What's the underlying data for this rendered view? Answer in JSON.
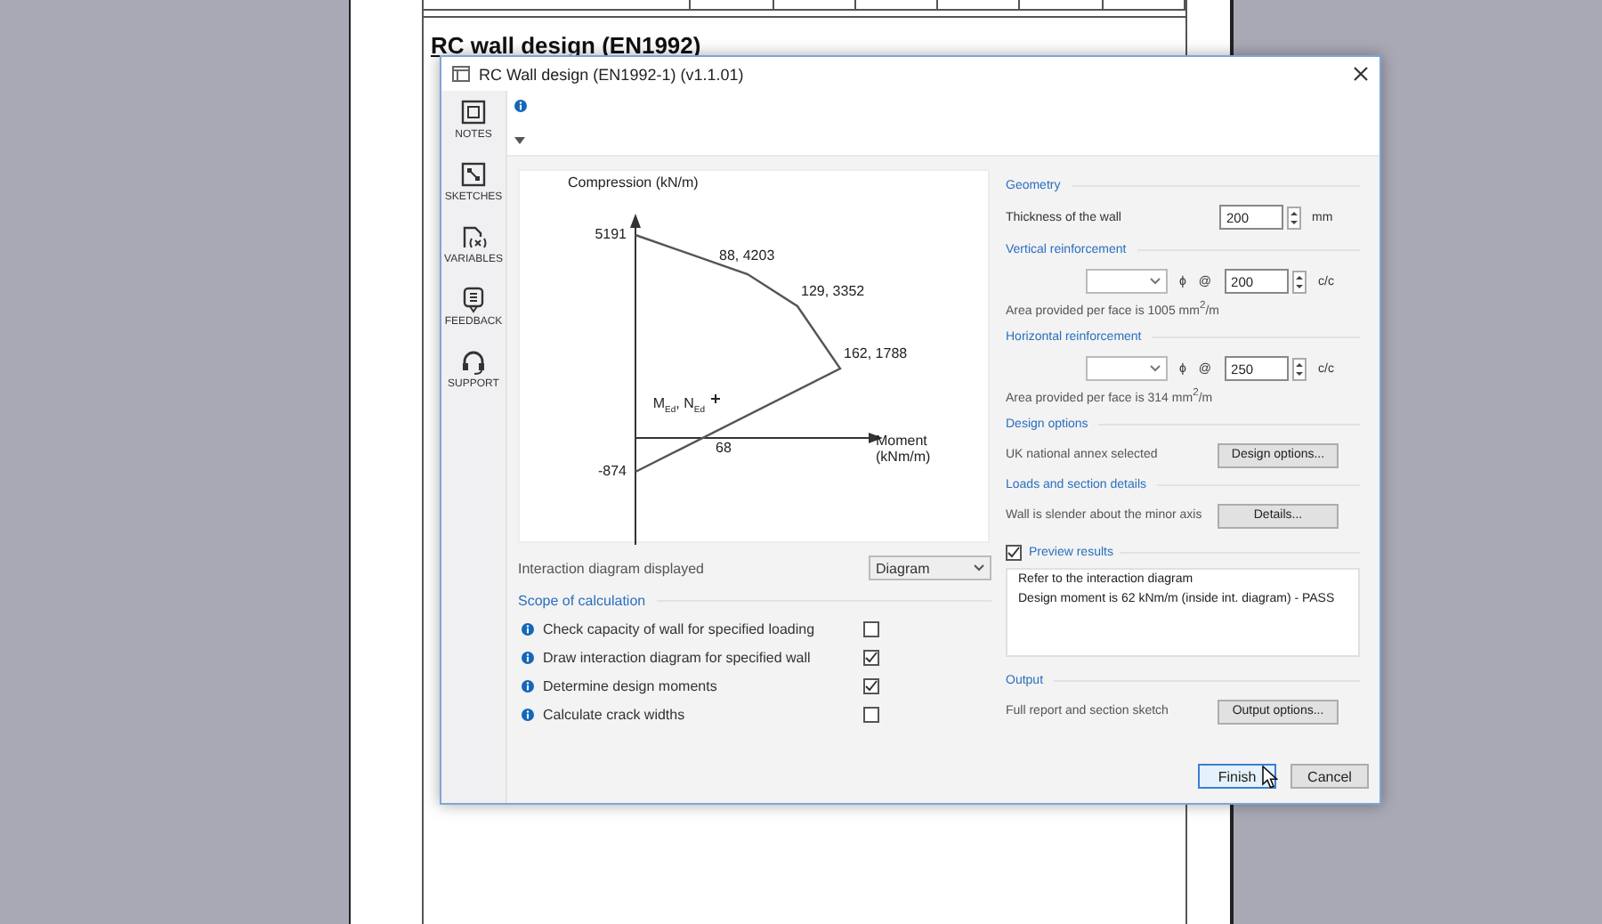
{
  "document": {
    "heading": "RC wall design (EN1992)"
  },
  "dialog": {
    "title": "RC Wall design (EN1992-1) (v1.1.01)"
  },
  "sidebar": {
    "items": [
      {
        "label": "NOTES",
        "kind": "notes"
      },
      {
        "label": "SKETCHES",
        "kind": "sketches"
      },
      {
        "label": "VARIABLES",
        "kind": "variables"
      },
      {
        "label": "FEEDBACK",
        "kind": "feedback"
      },
      {
        "label": "SUPPORT",
        "kind": "support"
      }
    ]
  },
  "diagram": {
    "y_axis_title": "Compression (kN/m)",
    "x_axis_title": "Moment (kNm/m)",
    "point_labels": [
      "5191",
      "88, 4203",
      "129, 3352",
      "162, 1788",
      "-874"
    ],
    "crossing_label": "68",
    "design_point_label": "M$_{Ed}$, N$_{Ed}$"
  },
  "display": {
    "label": "Interaction diagram displayed",
    "value": "Diagram"
  },
  "scope": {
    "title": "Scope of calculation",
    "items": [
      {
        "label": "Check capacity of wall for specified loading",
        "checked": false
      },
      {
        "label": "Draw interaction diagram for specified wall",
        "checked": true
      },
      {
        "label": "Determine design moments",
        "checked": true
      },
      {
        "label": "Calculate crack widths",
        "checked": false
      }
    ]
  },
  "geometry": {
    "title": "Geometry",
    "label": "Thickness of the wall",
    "value": "200",
    "unit": "mm"
  },
  "vertical": {
    "title": "Vertical reinforcement",
    "symbol": "ϕ",
    "at": "@",
    "spacing": "200",
    "unit": "c/c",
    "note": "Area provided per face is 1005 mm$^{2}$/m"
  },
  "horizontal": {
    "title": "Horizontal reinforcement",
    "symbol": "ϕ",
    "at": "@",
    "spacing": "250",
    "unit": "c/c",
    "note": "Area provided per face is 314 mm$^{2}$/m"
  },
  "design_options": {
    "title": "Design options",
    "text": "UK national annex selected",
    "button": "Design options..."
  },
  "loads": {
    "title": "Loads and section details",
    "text": "Wall is slender about the minor axis",
    "button": "Details..."
  },
  "preview": {
    "title": "Preview results",
    "checked": true,
    "lines": [
      "Refer to the interaction diagram",
      "Design moment is 62 kNm/m (inside int. diagram) - PASS"
    ]
  },
  "output": {
    "title": "Output",
    "text": "Full report and section sketch",
    "button": "Output options..."
  },
  "buttons": [
    {
      "label": "Finish",
      "kind": "default"
    },
    {
      "label": "Cancel",
      "kind": "normal"
    }
  ]
}
